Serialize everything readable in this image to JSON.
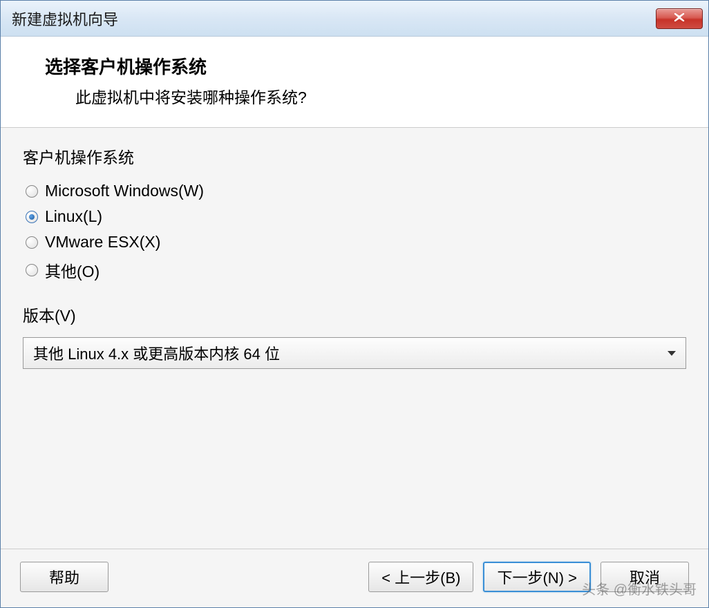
{
  "window": {
    "title": "新建虚拟机向导"
  },
  "header": {
    "title": "选择客户机操作系统",
    "subtitle": "此虚拟机中将安装哪种操作系统?"
  },
  "os_group": {
    "label": "客户机操作系统",
    "options": [
      {
        "label": "Microsoft Windows(W)",
        "checked": false
      },
      {
        "label": "Linux(L)",
        "checked": true
      },
      {
        "label": "VMware ESX(X)",
        "checked": false
      },
      {
        "label": "其他(O)",
        "checked": false
      }
    ]
  },
  "version": {
    "label": "版本(V)",
    "selected": "其他 Linux 4.x 或更高版本内核 64 位"
  },
  "buttons": {
    "help": "帮助",
    "back": "< 上一步(B)",
    "next": "下一步(N) >",
    "cancel": "取消"
  },
  "watermark": "头条 @衡水铁头哥"
}
